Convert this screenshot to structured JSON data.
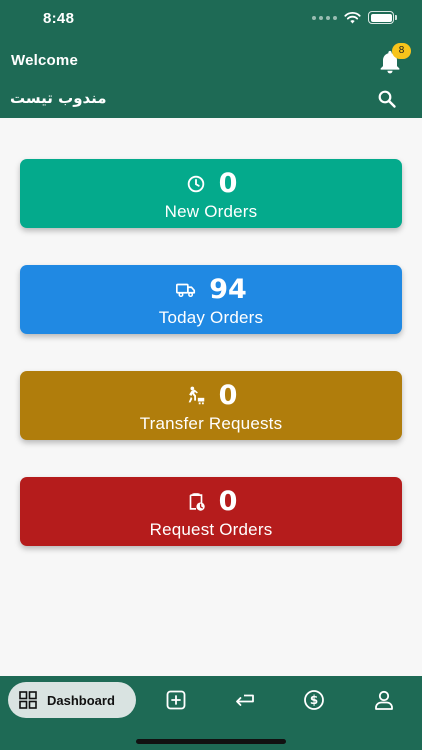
{
  "status_bar": {
    "time": "8:48"
  },
  "header": {
    "welcome": "Welcome",
    "agent_name": "مندوب تيست",
    "notification_count": "8",
    "icons": [
      "bell-icon",
      "search-icon"
    ],
    "color": "#1e6a55"
  },
  "cards": [
    {
      "count": "0",
      "label": "New Orders",
      "icon": "clock-icon",
      "color": "#04aa8c"
    },
    {
      "count": "94",
      "label": "Today Orders",
      "icon": "truck-icon",
      "color": "#2089e3"
    },
    {
      "count": "0",
      "label": "Transfer Requests",
      "icon": "person-transfer-icon",
      "color": "#b07d0c"
    },
    {
      "count": "0",
      "label": "Request Orders",
      "icon": "clipboard-clock-icon",
      "color": "#b51c1c"
    }
  ],
  "bottom_nav": {
    "active": "Dashboard",
    "items": [
      {
        "label": "Dashboard",
        "icon": "grid-icon"
      },
      {
        "icon": "add-square-icon"
      },
      {
        "icon": "return-arrow-icon"
      },
      {
        "icon": "dollar-icon"
      },
      {
        "icon": "user-icon"
      }
    ]
  }
}
